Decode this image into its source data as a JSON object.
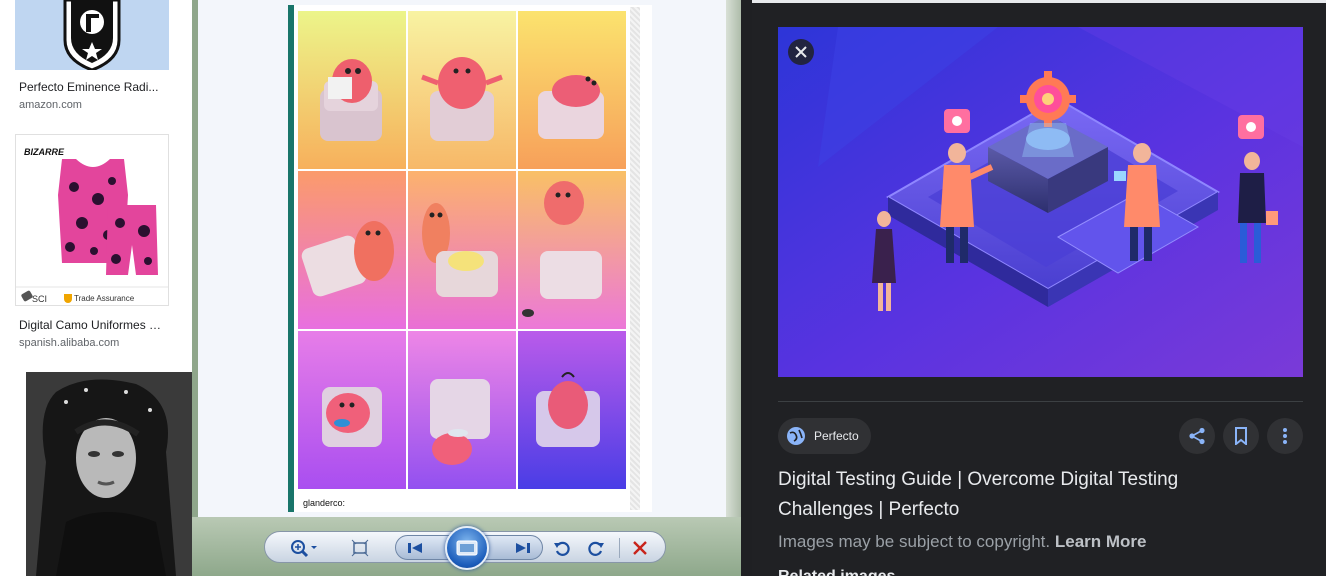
{
  "left_results": [
    {
      "caption": "Perfecto Eminence Radi...",
      "source": "amazon.com",
      "thumb_icon": "shield-logo"
    },
    {
      "caption": "Digital Camo Uniformes De...",
      "source": "spanish.alibaba.com",
      "thumb_icon": "jersey",
      "brand_text": "BIZARRE",
      "badge_text": "Trade Assurance",
      "corner_text": "SCI"
    },
    {
      "caption": "",
      "source": "",
      "thumb_icon": "portrait"
    }
  ],
  "viewer": {
    "comic_credit": "glanderco:",
    "toolbar_icons": [
      "zoom-icon",
      "fit-icon",
      "previous-icon",
      "slideshow-icon",
      "next-icon",
      "rotate-left-icon",
      "rotate-right-icon",
      "delete-icon"
    ]
  },
  "detail": {
    "source_name": "Perfecto",
    "title": "Digital Testing Guide | Overcome Digital Testing Challenges | Perfecto",
    "copyright_text": "Images may be subject to copyright.",
    "learn_more": "Learn More",
    "related_label": "Related images",
    "colors": {
      "panel_bg": "#202124",
      "chip_bg": "#303134",
      "text": "#e8eaed",
      "muted": "#9aa0a6"
    }
  }
}
